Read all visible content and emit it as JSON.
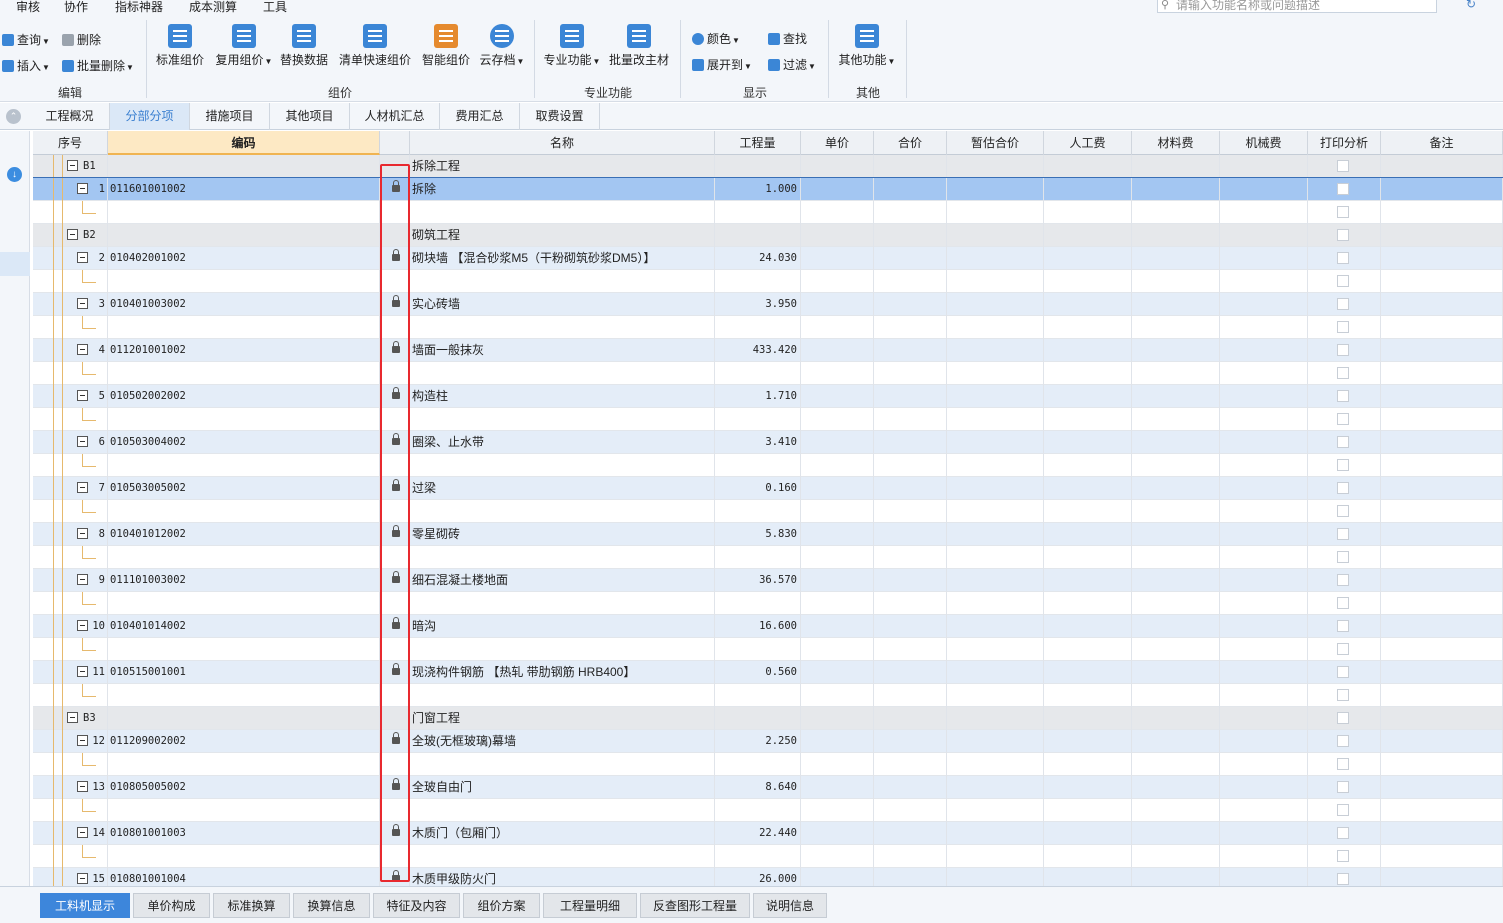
{
  "menu": [
    "审核",
    "协作",
    "指标神器",
    "成本测算",
    "工具"
  ],
  "search_placeholder": "请输入功能名称或问题描述",
  "ribbon": {
    "edit": {
      "query": "查询",
      "delete": "删除",
      "insert": "插入",
      "batch_delete": "批量删除",
      "label": "编辑"
    },
    "pricing": {
      "items": [
        "标准组价",
        "复用组价",
        "替换数据",
        "清单快速组价",
        "智能组价",
        "云存档"
      ],
      "label": "组价"
    },
    "special": {
      "items": [
        "专业功能",
        "批量改主材"
      ],
      "label": "专业功能"
    },
    "display": {
      "color": "颜色",
      "find": "查找",
      "expand": "展开到",
      "filter": "过滤",
      "label": "显示"
    },
    "other": {
      "items": [
        "其他功能"
      ],
      "label": "其他"
    }
  },
  "tabs": [
    "工程概况",
    "分部分项",
    "措施项目",
    "其他项目",
    "人材机汇总",
    "费用汇总",
    "取费设置"
  ],
  "active_tab": 1,
  "columns": [
    "序号",
    "编码",
    "",
    "名称",
    "工程量",
    "单价",
    "合价",
    "暂估合价",
    "人工费",
    "材料费",
    "机械费",
    "打印分析",
    "备注"
  ],
  "rows": [
    {
      "type": "grp",
      "seq": "B1",
      "name": "拆除工程"
    },
    {
      "type": "item",
      "seq": "1",
      "code": "011601001002",
      "name": "拆除",
      "qty": "1.000",
      "selected": true
    },
    {
      "type": "blank"
    },
    {
      "type": "grp",
      "seq": "B2",
      "name": "砌筑工程"
    },
    {
      "type": "item",
      "seq": "2",
      "code": "010402001002",
      "name": "砌块墙 【混合砂浆M5（干粉砌筑砂浆DM5）】",
      "qty": "24.030"
    },
    {
      "type": "blank"
    },
    {
      "type": "item",
      "seq": "3",
      "code": "010401003002",
      "name": "实心砖墙",
      "qty": "3.950"
    },
    {
      "type": "blank"
    },
    {
      "type": "item",
      "seq": "4",
      "code": "011201001002",
      "name": "墙面一般抹灰",
      "qty": "433.420"
    },
    {
      "type": "blank"
    },
    {
      "type": "item",
      "seq": "5",
      "code": "010502002002",
      "name": "构造柱",
      "qty": "1.710"
    },
    {
      "type": "blank"
    },
    {
      "type": "item",
      "seq": "6",
      "code": "010503004002",
      "name": "圈梁、止水带",
      "qty": "3.410"
    },
    {
      "type": "blank"
    },
    {
      "type": "item",
      "seq": "7",
      "code": "010503005002",
      "name": "过梁",
      "qty": "0.160"
    },
    {
      "type": "blank"
    },
    {
      "type": "item",
      "seq": "8",
      "code": "010401012002",
      "name": "零星砌砖",
      "qty": "5.830"
    },
    {
      "type": "blank"
    },
    {
      "type": "item",
      "seq": "9",
      "code": "011101003002",
      "name": "细石混凝土楼地面",
      "qty": "36.570"
    },
    {
      "type": "blank"
    },
    {
      "type": "item",
      "seq": "10",
      "code": "010401014002",
      "name": "暗沟",
      "qty": "16.600"
    },
    {
      "type": "blank"
    },
    {
      "type": "item",
      "seq": "11",
      "code": "010515001001",
      "name": "现浇构件钢筋 【热轧 带肋钢筋 HRB400】",
      "qty": "0.560"
    },
    {
      "type": "blank"
    },
    {
      "type": "grp",
      "seq": "B3",
      "name": "门窗工程"
    },
    {
      "type": "item",
      "seq": "12",
      "code": "011209002002",
      "name": "全玻(无框玻璃)幕墙",
      "qty": "2.250"
    },
    {
      "type": "blank"
    },
    {
      "type": "item",
      "seq": "13",
      "code": "010805005002",
      "name": "全玻自由门",
      "qty": "8.640"
    },
    {
      "type": "blank"
    },
    {
      "type": "item",
      "seq": "14",
      "code": "010801001003",
      "name": "木质门（包厢门）",
      "qty": "22.440"
    },
    {
      "type": "blank"
    },
    {
      "type": "item",
      "seq": "15",
      "code": "010801001004",
      "name": "木质甲级防火门",
      "qty": "26.000"
    }
  ],
  "bottom_tabs": [
    "工料机显示",
    "单价构成",
    "标准换算",
    "换算信息",
    "特征及内容",
    "组价方案",
    "工程量明细",
    "反查图形工程量",
    "说明信息"
  ],
  "active_bottom_tab": 0
}
